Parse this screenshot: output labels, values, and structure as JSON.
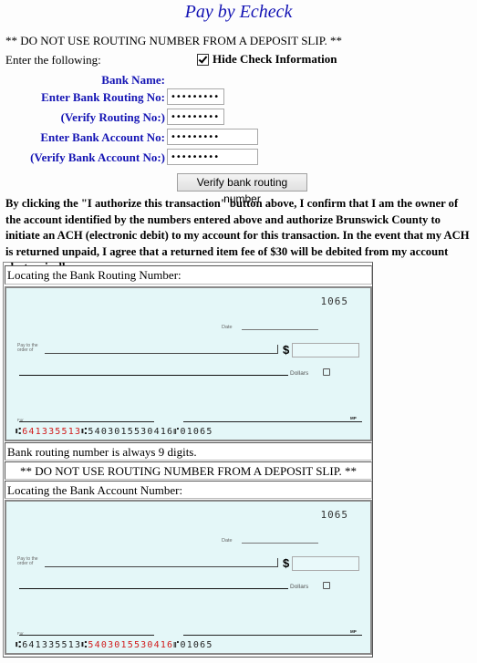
{
  "header": {
    "title": "Pay by Echeck"
  },
  "warning_top": "** DO NOT USE ROUTING NUMBER FROM A DEPOSIT SLIP. **",
  "enter_label": "Enter the following:",
  "hide_check": {
    "label": "Hide Check Information",
    "checked": true
  },
  "form": {
    "bank_name_label": "Bank Name:",
    "bank_name_value": "",
    "routing_label": "Enter Bank Routing No:",
    "routing_value": "•••••••••",
    "verify_routing_label": "(Verify Routing No:)",
    "verify_routing_value": "•••••••••",
    "account_label": "Enter Bank Account No:",
    "account_value": "•••••••••",
    "verify_account_label": "(Verify Bank Account No:)",
    "verify_account_value": "•••••••••",
    "verify_button": "Verify bank routing number"
  },
  "authorization_text": "By clicking the \"I authorize this transaction\" button above, I confirm that I am the owner of the account identified by the numbers entered above and authorize Brunswick County to initiate an ACH (electronic debit) to my account for this transaction. In the event that my ACH is returned unpaid, I agree that a returned item fee of $30 will be debited from my account electronically.",
  "help_table": {
    "routing_heading": "Locating the Bank Routing Number:",
    "routing_note": "Bank routing number is always 9 digits.",
    "warning": "** DO NOT USE ROUTING NUMBER FROM A DEPOSIT SLIP. **",
    "account_heading": "Locating the Bank Account Number:"
  },
  "check_image": {
    "check_number": "1065",
    "date_label": "Date",
    "pay_to_label_1": "Pay to the",
    "pay_to_label_2": "order of",
    "dollar_sign": "$",
    "dollars_label": "Dollars",
    "for_label": "For",
    "signature_mark": "MP",
    "micr_prefix": "⑆",
    "routing_number": "641335513",
    "routing_sep": "⑆",
    "account_number": "5403015530416",
    "account_sep": "⑈",
    "micr_check_number": "01065",
    "highlight_color": "#d11a1a"
  }
}
